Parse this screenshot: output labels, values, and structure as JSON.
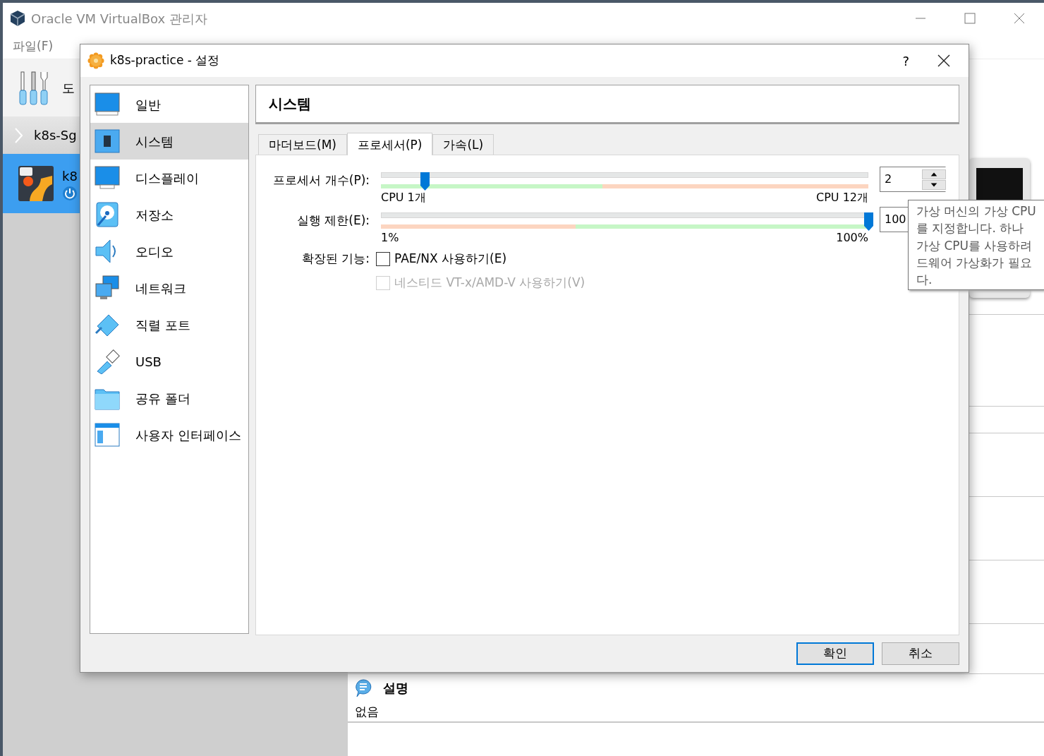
{
  "manager": {
    "title": "Oracle VM VirtualBox 관리자",
    "menu": [
      "파일(F)"
    ],
    "tools_label": "도",
    "group": {
      "name": "k8s-Sg",
      "expanded": false
    },
    "vm": {
      "name": "k8",
      "selected": true
    },
    "description": {
      "heading": "설명",
      "text": "없음"
    }
  },
  "dialog": {
    "title": "k8s-practice - 설정",
    "help": "?",
    "sections": [
      {
        "label": "일반",
        "selected": false
      },
      {
        "label": "시스템",
        "selected": true
      },
      {
        "label": "디스플레이",
        "selected": false
      },
      {
        "label": "저장소",
        "selected": false
      },
      {
        "label": "오디오",
        "selected": false
      },
      {
        "label": "네트워크",
        "selected": false
      },
      {
        "label": "직렬 포트",
        "selected": false
      },
      {
        "label": "USB",
        "selected": false
      },
      {
        "label": "공유 폴더",
        "selected": false
      },
      {
        "label": "사용자 인터페이스",
        "selected": false
      }
    ],
    "page_title": "시스템",
    "tabs": [
      {
        "label": "마더보드(M)",
        "selected": false
      },
      {
        "label": "프로세서(P)",
        "selected": true
      },
      {
        "label": "가속(L)",
        "selected": false
      }
    ],
    "sliders": [
      {
        "label": "프로세서 개수(P):",
        "level": 0.09,
        "min_label": "CPU 1개",
        "max_label": "CPU 12개",
        "value": "2"
      },
      {
        "label": "실행 제한(E):",
        "level": 1,
        "min_label": "1%",
        "max_label": "100%",
        "value": "100"
      }
    ],
    "features_label": "확장된 기능:",
    "options": [
      {
        "label": "PAE/NX 사용하기(E)",
        "checked": false,
        "disabled": false
      },
      {
        "label": "네스티드 VT-x/AMD-V 사용하기(V)",
        "checked": false,
        "disabled": true
      }
    ],
    "buttons": [
      {
        "label": "확인",
        "default": true
      },
      {
        "label": "취소",
        "default": false
      }
    ]
  },
  "tooltip": {
    "lines": [
      "가상 머신의 가상 CPU",
      "를 지정합니다. 하나",
      "가상 CPU를 사용하려",
      "드웨어 가상화가 필요",
      "다."
    ]
  }
}
